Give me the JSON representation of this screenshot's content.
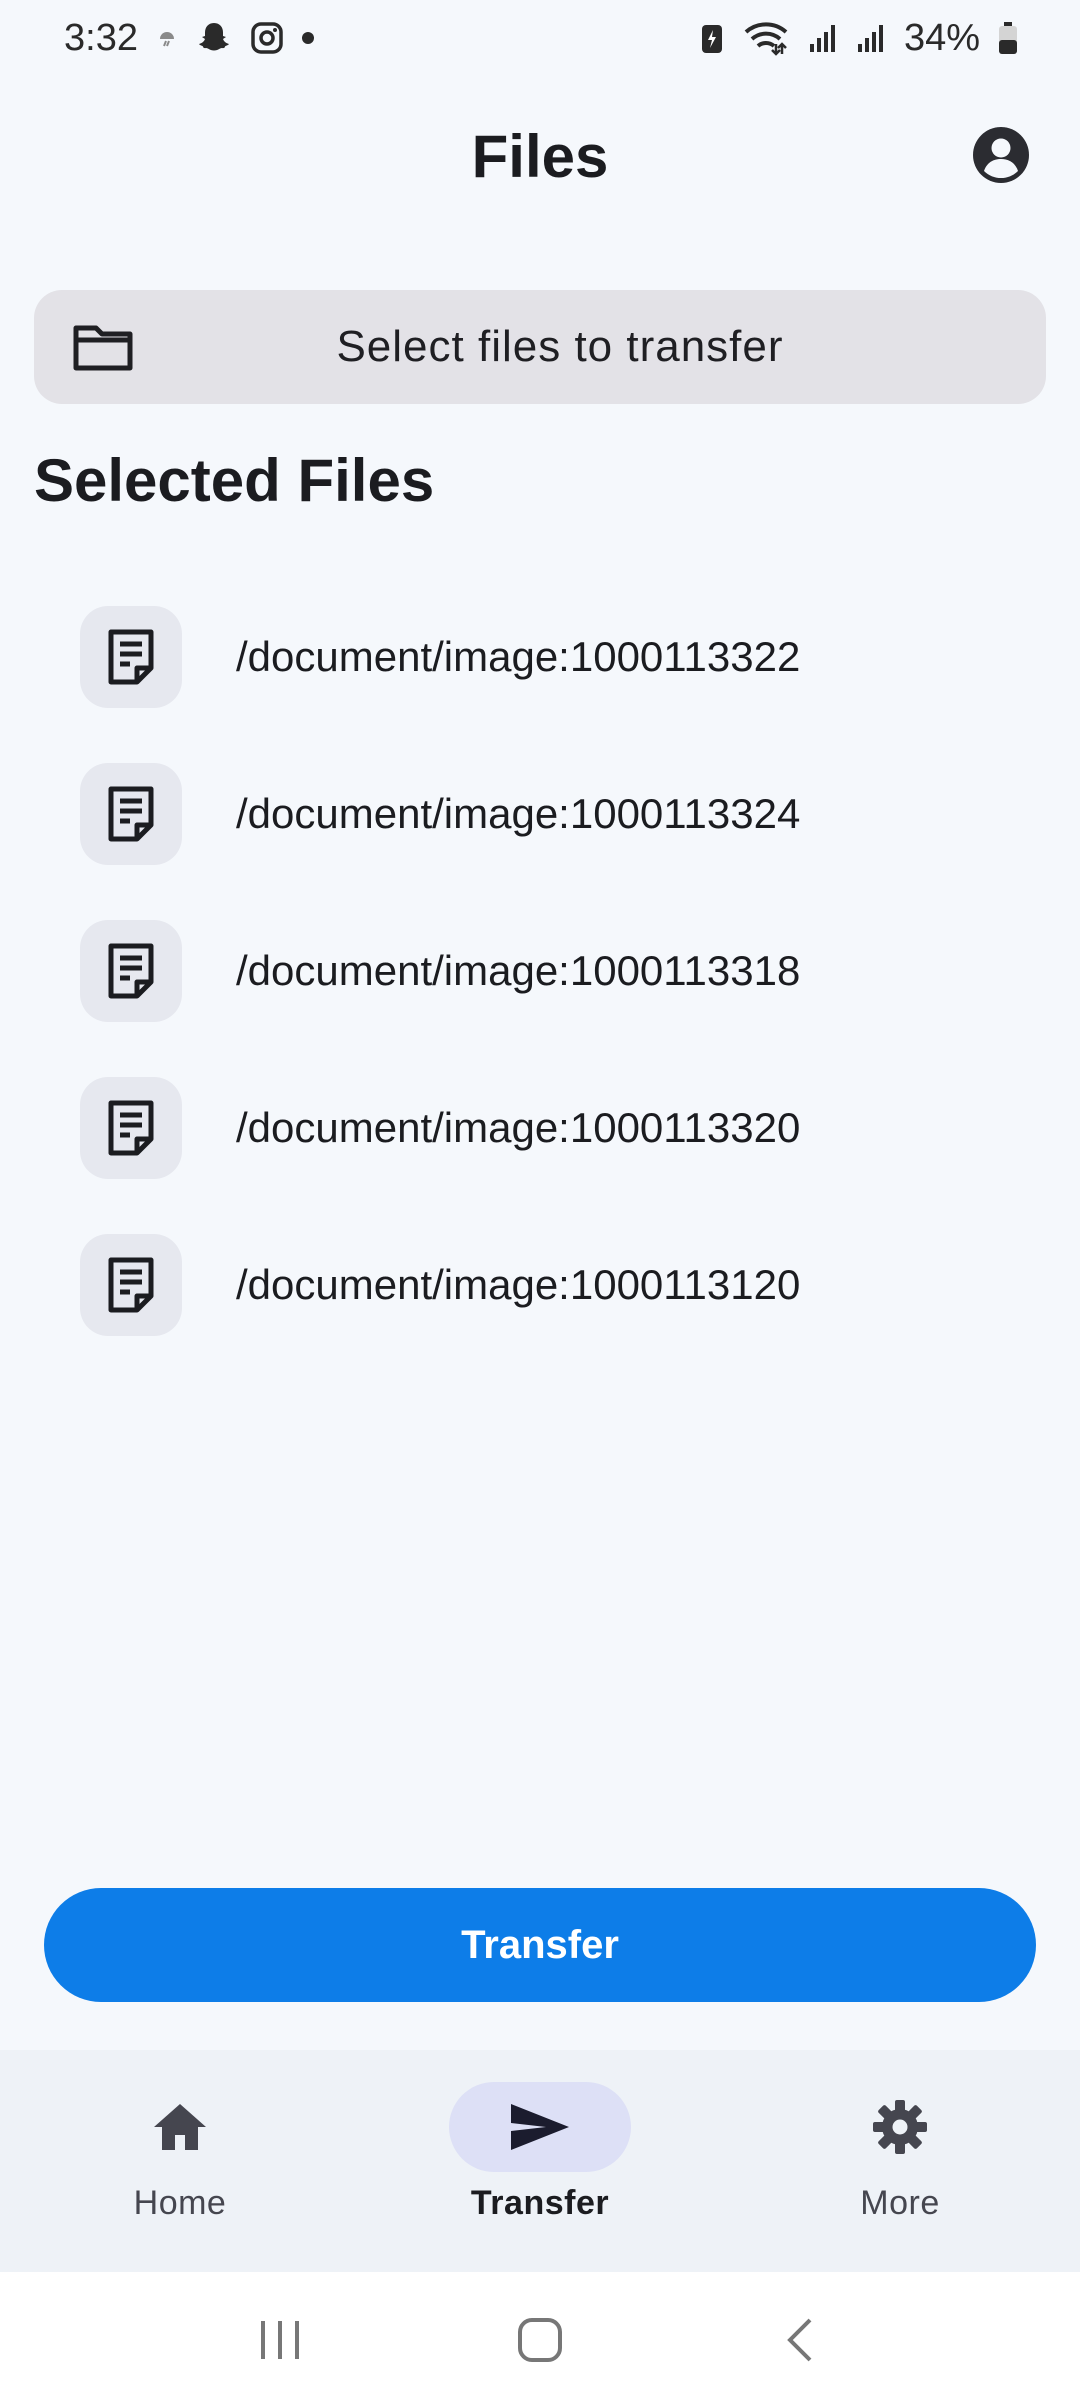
{
  "status_bar": {
    "time": "3:32",
    "battery": "34%"
  },
  "app_bar": {
    "title": "Files",
    "account_icon": "account-circle-icon"
  },
  "select_files": {
    "label": "Select files to transfer",
    "icon": "folder-icon"
  },
  "section": {
    "title": "Selected Files"
  },
  "files": [
    {
      "name": "/document/image:1000113322",
      "icon": "document-icon"
    },
    {
      "name": "/document/image:1000113324",
      "icon": "document-icon"
    },
    {
      "name": "/document/image:1000113318",
      "icon": "document-icon"
    },
    {
      "name": "/document/image:1000113320",
      "icon": "document-icon"
    },
    {
      "name": "/document/image:1000113120",
      "icon": "document-icon"
    }
  ],
  "transfer_button": {
    "label": "Transfer",
    "color": "#0d7de8"
  },
  "bottom_nav": {
    "items": [
      {
        "label": "Home",
        "icon": "home-icon",
        "active": false
      },
      {
        "label": "Transfer",
        "icon": "send-icon",
        "active": true
      },
      {
        "label": "More",
        "icon": "gear-icon",
        "active": false
      }
    ]
  },
  "colors": {
    "background": "#f5f8fc",
    "accent": "#0d7de8",
    "nav_active_pill": "#dde0f6"
  }
}
